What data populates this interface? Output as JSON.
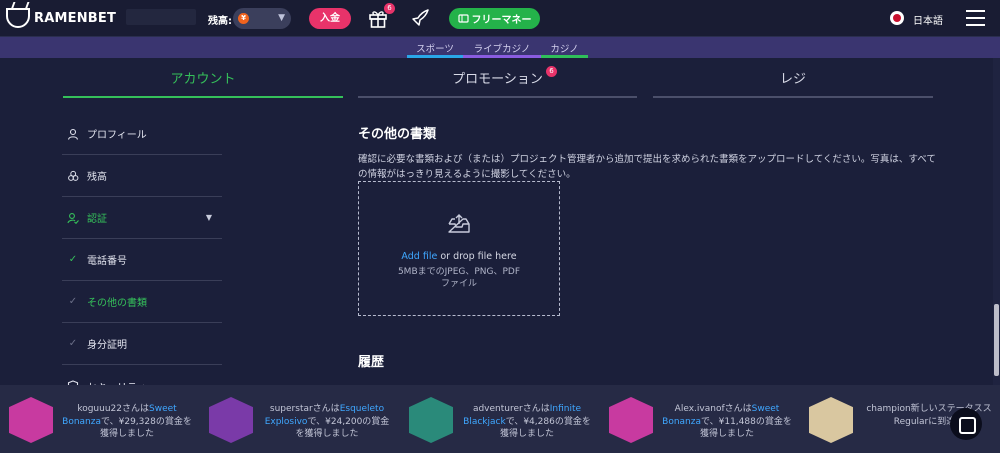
{
  "topbar": {
    "brand": "RAMENBET",
    "balance_label": "残高:",
    "currency_icon": "yen-coin-icon",
    "currency_symbol": "¥",
    "deposit_label": "入金",
    "gift_badge": "6",
    "free_money_label": "フリーマネー",
    "language": "日本語"
  },
  "subnav": {
    "items": [
      {
        "label": "スポーツ",
        "color": "#2aa7e8"
      },
      {
        "label": "ライブカジノ",
        "color": "#8a5ce0"
      },
      {
        "label": "カジノ",
        "color": "#2fbf5a"
      }
    ]
  },
  "tabs": [
    {
      "label": "アカウント",
      "active": true
    },
    {
      "label": "プロモーション",
      "badge": "6"
    },
    {
      "label": "レジ"
    }
  ],
  "sidebar": {
    "items": [
      {
        "label": "プロフィール",
        "icon": "user-icon"
      },
      {
        "label": "残高",
        "icon": "coins-icon"
      },
      {
        "label": "認証",
        "icon": "user-check-icon"
      },
      {
        "label": "電話番号",
        "icon": "check-icon"
      },
      {
        "label": "その他の書類",
        "icon": "check-icon"
      },
      {
        "label": "身分証明",
        "icon": "check-icon"
      },
      {
        "label": "セキュリティー",
        "icon": "shield-icon"
      }
    ]
  },
  "main": {
    "title": "その他の書類",
    "description": "確認に必要な書類および（または）プロジェクト管理者から追加で提出を求められた書類をアップロードしてください。写真は、すべての情報がはっきり見えるように撮影してください。",
    "dropzone": {
      "link": "Add file",
      "text": " or drop file here",
      "formats": "5MBまでのJPEG、PNG、PDF",
      "formats2": "ファイル"
    },
    "history_title": "履歴"
  },
  "ticker": [
    {
      "user": "koguuu22さんは",
      "game": "Sweet Bonanza",
      "rest": "で、¥29,328の賞金を獲得しました",
      "thumb_color": "#c83aa0"
    },
    {
      "user": "superstarさんは",
      "game": "Esqueleto Explosivo",
      "rest": "で、¥24,200の賞金を獲得しました",
      "thumb_color": "#7a3aa8"
    },
    {
      "user": "adventurerさんは",
      "game": "Infinite Blackjack",
      "rest": "で、¥4,286の賞金を獲得しました",
      "thumb_color": "#2a8a7a"
    },
    {
      "user": "Alex.ivanofさんは",
      "game": "Sweet Bonanza",
      "rest": "で、¥11,488の賞金を獲得しました",
      "thumb_color": "#c83aa0"
    },
    {
      "user": "champion新しいステータス",
      "game": "",
      "rest": "スRegularに到達し",
      "thumb_color": "#d9c7a0"
    }
  ],
  "colors": {
    "accent_green": "#35c05a",
    "accent_pink": "#e8336a",
    "link_blue": "#3fa7ff",
    "background": "#1b1f3a"
  }
}
